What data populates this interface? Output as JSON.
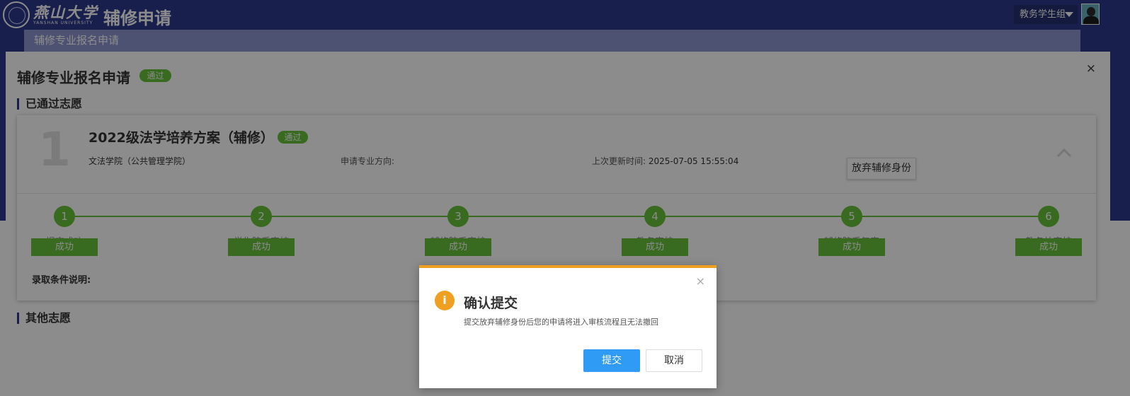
{
  "header": {
    "logo_cn": "燕山大学",
    "logo_en": "YANSHAN UNIVERSITY",
    "title": "辅修申请",
    "user_group": "教务学生组"
  },
  "subnav": {
    "tab": "辅修专业报名申请"
  },
  "panel": {
    "title": "辅修专业报名申请",
    "status": "通过",
    "close": "×",
    "approved_section": "已通过志愿",
    "other_section": "其他志愿"
  },
  "card": {
    "rank": "1",
    "plan_name": "2022级法学培养方案（辅修）",
    "status": "通过",
    "college": "文法学院（公共管理学院）",
    "direction_label": "申请专业方向:",
    "direction_value": "",
    "updated_label": "上次更新时间:",
    "updated_value": "2025-07-05 15:55:04",
    "abandon_button": "放弃辅修身份",
    "admission_note": "录取条件说明:"
  },
  "steps": [
    {
      "num": "1",
      "label": "提交成功",
      "status": "成功"
    },
    {
      "num": "2",
      "label": "学生院系审核",
      "status": "成功"
    },
    {
      "num": "3",
      "label": "辅修院系审核",
      "status": "成功"
    },
    {
      "num": "4",
      "label": "教务审核",
      "status": "成功"
    },
    {
      "num": "5",
      "label": "辅修院系复审",
      "status": "成功"
    },
    {
      "num": "6",
      "label": "教务处审核",
      "status": "成功"
    }
  ],
  "dialog": {
    "title": "确认提交",
    "message": "提交放弃辅修身份后您的申请将进入审核流程且无法撤回",
    "submit": "提交",
    "cancel": "取消",
    "close": "×",
    "icon": "info-icon"
  },
  "colors": {
    "header_bg": "#2e3a8c",
    "success": "#67c23a",
    "warning": "#f0a020",
    "primary": "#2f9bf4"
  }
}
